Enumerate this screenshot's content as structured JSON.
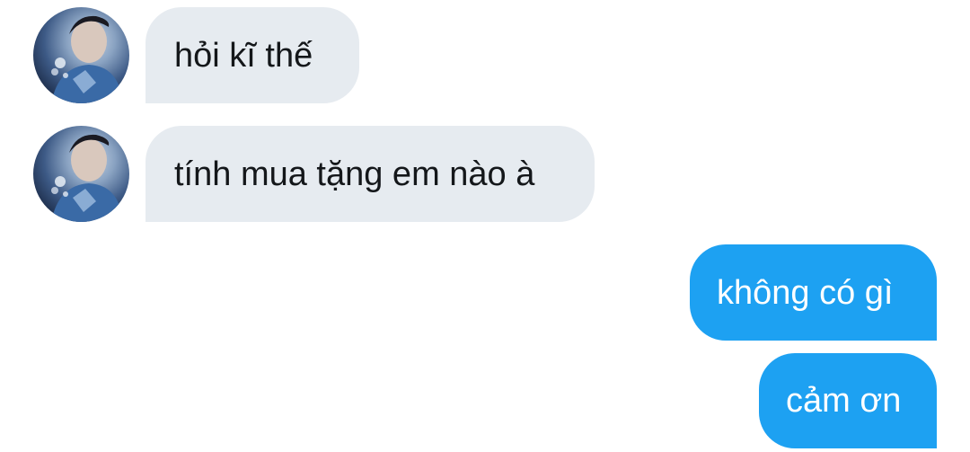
{
  "conversation": {
    "messages": [
      {
        "direction": "incoming",
        "text": "hỏi kĩ thế"
      },
      {
        "direction": "incoming",
        "text": "tính mua tặng em nào à"
      },
      {
        "direction": "outgoing",
        "text": "không có gì"
      },
      {
        "direction": "outgoing",
        "text": "cảm ơn"
      }
    ]
  },
  "colors": {
    "incoming_bubble": "#e6ebf0",
    "incoming_text": "#14171a",
    "outgoing_bubble": "#1da1f2",
    "outgoing_text": "#ffffff",
    "background": "#ffffff"
  },
  "icons": {
    "sender_avatar": "avatar-photo"
  }
}
